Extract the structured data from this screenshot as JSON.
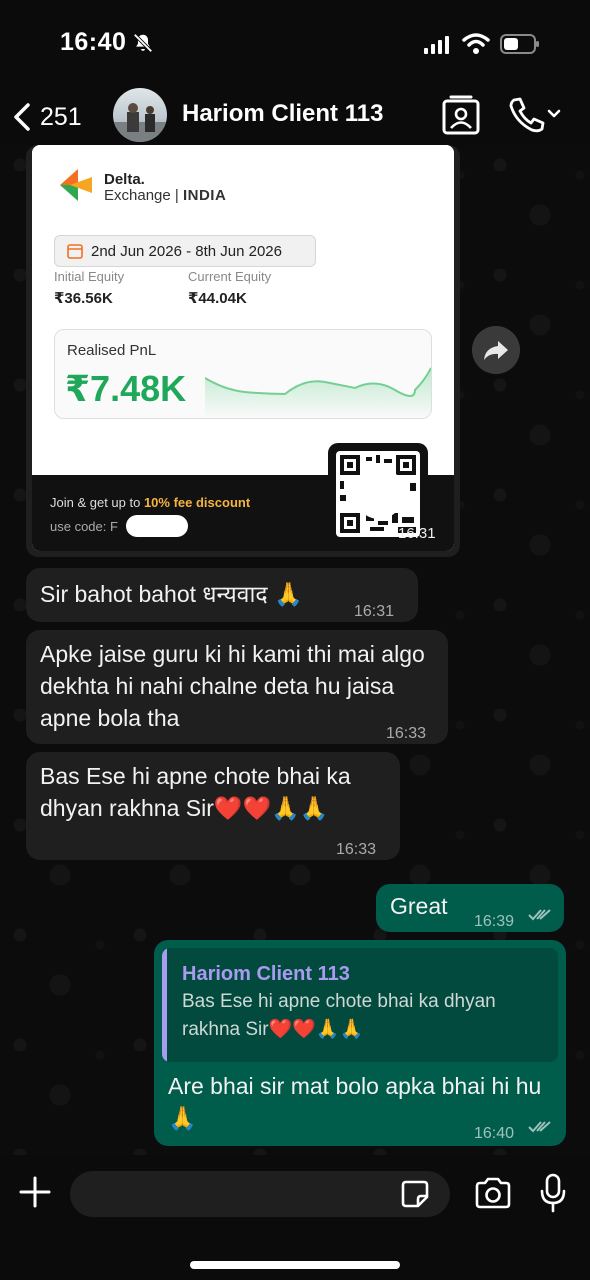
{
  "status_bar": {
    "time": "16:40"
  },
  "header": {
    "back_count": "251",
    "contact_name": "Hariom Client 113"
  },
  "card": {
    "brand_name": "Delta.",
    "brand_sub": "Exchange",
    "brand_region": "INDIA",
    "date_range": "2nd Jun 2026 - 8th Jun 2026",
    "initial_equity_label": "Initial Equity",
    "initial_equity_value": "₹36.56K",
    "current_equity_label": "Current Equity",
    "current_equity_value": "₹44.04K",
    "pnl_label": "Realised PnL",
    "pnl_value": "₹7.48K",
    "promo_prefix": "Join & get up to ",
    "promo_highlight": "10% fee discount",
    "promo_code_label": "use code: F",
    "time": "16:31",
    "accent_color": "#1fa85a"
  },
  "messages": [
    {
      "text": "Sir bahot bahot धन्यवाद 🙏",
      "time": "16:31"
    },
    {
      "text": "Apke jaise guru ki hi kami thi mai algo dekhta hi nahi chalne deta hu jaisa apne bola tha",
      "time": "16:33"
    },
    {
      "text": "Bas Ese hi apne chote bhai ka dhyan rakhna Sir❤️❤️🙏🙏",
      "time": "16:33"
    },
    {
      "text": "Great",
      "time": "16:39"
    },
    {
      "quote_author": "Hariom Client 113",
      "quote_text": "Bas Ese hi apne chote bhai ka dhyan rakhna Sir❤️❤️🙏🙏",
      "text": "Are bhai sir mat bolo apka bhai hi hu🙏",
      "time": "16:40"
    }
  ],
  "composer": {
    "placeholder": ""
  },
  "colors": {
    "outgoing_bubble": "#005c4b",
    "incoming_bubble": "#1f1f1f",
    "quote_author": "#a89bf0"
  }
}
